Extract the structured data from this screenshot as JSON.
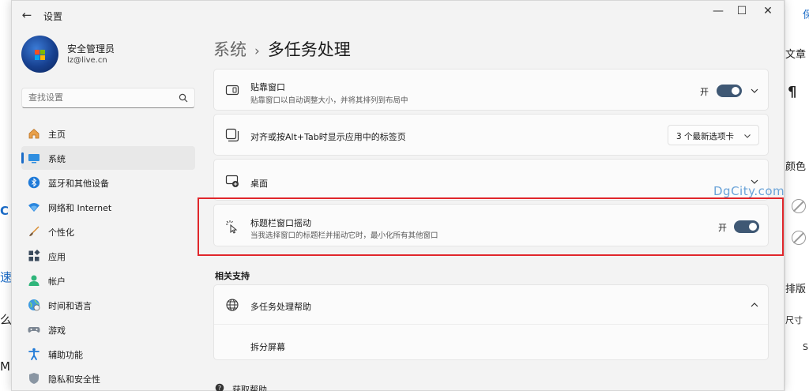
{
  "background": {
    "left_fragments": [
      "C",
      "速",
      "么",
      "Mi"
    ],
    "right_fragments": [
      "保",
      "文章",
      "¶",
      "颜色",
      "排版",
      "尺寸",
      "S"
    ]
  },
  "window": {
    "app_title": "设置",
    "controls": {
      "minimize": "—",
      "maximize": "☐",
      "close": "✕"
    }
  },
  "profile": {
    "name": "安全管理员",
    "email": "lz@live.cn"
  },
  "search": {
    "placeholder": "查找设置"
  },
  "nav": [
    {
      "label": "主页",
      "icon": "home-icon"
    },
    {
      "label": "系统",
      "icon": "system-icon",
      "active": true
    },
    {
      "label": "蓝牙和其他设备",
      "icon": "bluetooth-icon"
    },
    {
      "label": "网络和 Internet",
      "icon": "wifi-icon"
    },
    {
      "label": "个性化",
      "icon": "brush-icon"
    },
    {
      "label": "应用",
      "icon": "apps-icon"
    },
    {
      "label": "帐户",
      "icon": "account-icon"
    },
    {
      "label": "时间和语言",
      "icon": "globe-clock-icon"
    },
    {
      "label": "游戏",
      "icon": "gamepad-icon"
    },
    {
      "label": "辅助功能",
      "icon": "accessibility-icon"
    },
    {
      "label": "隐私和安全性",
      "icon": "shield-icon"
    }
  ],
  "breadcrumb": {
    "parent": "系统",
    "separator": "›",
    "current": "多任务处理"
  },
  "cards": {
    "snap": {
      "title": "贴靠窗口",
      "desc": "贴靠窗口以自动调整大小，并将其排列到布局中",
      "toggle_label": "开"
    },
    "alttab": {
      "title": "对齐或按Alt+Tab时显示应用中的标签页",
      "dropdown_value": "3 个最新选项卡"
    },
    "desktops": {
      "title": "桌面"
    },
    "shake": {
      "title": "标题栏窗口摇动",
      "desc": "当我选择窗口的标题栏并摇动它时，最小化所有其他窗口",
      "toggle_label": "开"
    }
  },
  "related": {
    "header": "相关支持",
    "help": {
      "title": "多任务处理帮助",
      "sub_link": "拆分屏幕"
    }
  },
  "footer": {
    "get_help": "获取帮助"
  },
  "watermark": "DgCity.com",
  "colors": {
    "accent": "#3f5874",
    "highlight": "#e0262b",
    "nav_indicator": "#1a6bc7"
  }
}
